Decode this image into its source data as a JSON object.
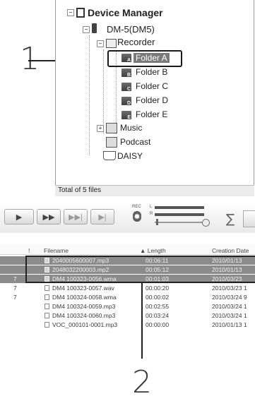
{
  "callouts": {
    "one": "1",
    "two": "2"
  },
  "tree": {
    "root_label": "Device Manager",
    "device_label": "DM-5(DM5)",
    "recorder_label": "Recorder",
    "folders": [
      {
        "label": "Folder  A",
        "letter": "A",
        "selected": true
      },
      {
        "label": "Folder B",
        "letter": "B"
      },
      {
        "label": "Folder C",
        "letter": "C"
      },
      {
        "label": "Folder D",
        "letter": "D"
      },
      {
        "label": "Folder E",
        "letter": "E"
      }
    ],
    "music_label": "Music",
    "podcast_label": "Podcast",
    "daisy_label": "DAISY",
    "status": "Total of 5 files"
  },
  "toolbar": {
    "play": "▶",
    "fast_forward": "▶▶",
    "skip_next": "▶▶|",
    "skip_end": "▶|",
    "rec_label": "REC",
    "level_left": "L",
    "level_right": "R"
  },
  "file_list": {
    "columns": [
      "!",
      "Filename",
      "▲ Length",
      "Creation Date"
    ],
    "rows": [
      {
        "mark": "",
        "name": "2040005600007.mp3",
        "length": "00:06:11",
        "date": "2010/01/13",
        "selected": true
      },
      {
        "mark": "",
        "name": "2048032200003.mp2",
        "length": "00:05:12",
        "date": "2010/01/13",
        "selected": true
      },
      {
        "mark": "7",
        "name": "DM4 100323-0056.wma",
        "length": "00:01:03",
        "date": "2010/03/23",
        "selected": true
      },
      {
        "mark": "7",
        "name": "DM4 100323-0057.wav",
        "length": "00:00:20",
        "date": "2010/03/23 1",
        "selected": false
      },
      {
        "mark": "7",
        "name": "DM4 100324-0058.wma",
        "length": "00:00:02",
        "date": "2010/03/24 9",
        "selected": false
      },
      {
        "mark": "",
        "name": "DM4 100324-0059.mp3",
        "length": "00:02:55",
        "date": "2010/03/24 1",
        "selected": false
      },
      {
        "mark": "",
        "name": "DM4 100324-0060.mp3",
        "length": "00:03:24",
        "date": "2010/03/24 1",
        "selected": false
      },
      {
        "mark": "",
        "name": "VOC_000101-0001.mp3",
        "length": "00:00:00",
        "date": "2010/01/13 1",
        "selected": false
      }
    ]
  }
}
